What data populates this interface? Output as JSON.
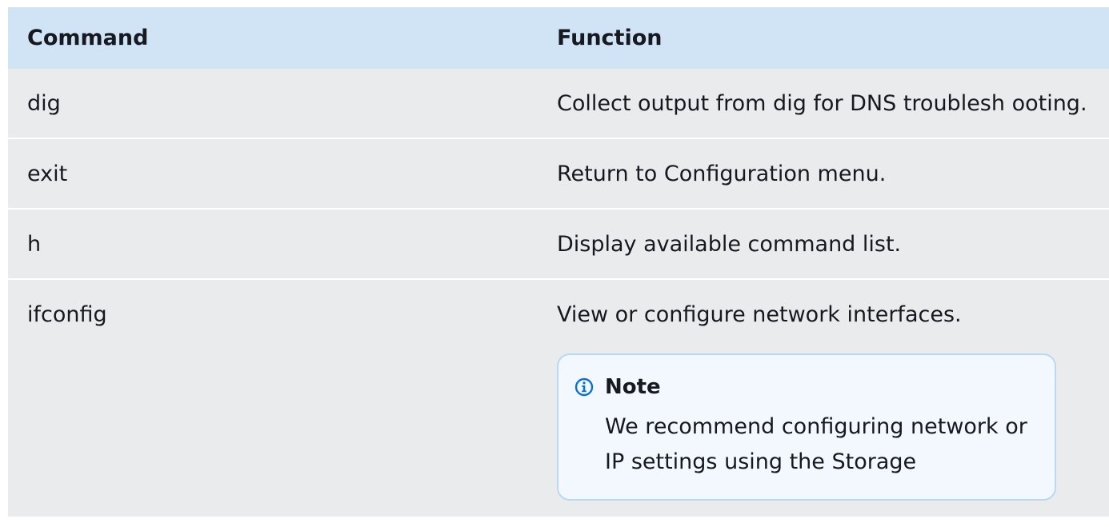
{
  "table": {
    "headers": {
      "command": "Command",
      "function": "Function"
    },
    "rows": [
      {
        "command": "dig",
        "function": "Collect output from dig for DNS troublesh ooting."
      },
      {
        "command": "exit",
        "function": "Return to Configuration menu."
      },
      {
        "command": "h",
        "function": "Display available command list."
      },
      {
        "command": "ifconfig",
        "function": "View or configure network interfaces."
      }
    ]
  },
  "note": {
    "icon": "info-icon",
    "title": "Note",
    "text": "We recommend configuring network or IP settings using  the Storage"
  },
  "colors": {
    "header_bg": "#d1e4f6",
    "row_bg": "#e9ebed",
    "note_bg": "#f2f8fd",
    "note_border": "#b9d8f4",
    "icon": "#0972d3"
  }
}
